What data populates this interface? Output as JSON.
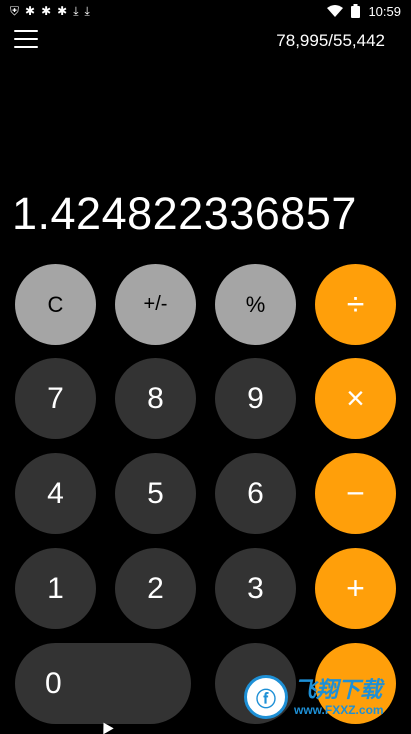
{
  "status_bar": {
    "left_icons": [
      "shield-icon",
      "bug-icon",
      "bug-icon",
      "bug-icon",
      "download-icon",
      "download-icon"
    ],
    "time": "10:59"
  },
  "header": {
    "expression": "78,995/55,442"
  },
  "display": {
    "value": "1.424822336857"
  },
  "keys": {
    "clear": "C",
    "plus_minus": "+/-",
    "percent": "%",
    "divide": "÷",
    "seven": "7",
    "eight": "8",
    "nine": "9",
    "multiply": "×",
    "four": "4",
    "five": "5",
    "six": "6",
    "minus": "−",
    "one": "1",
    "two": "2",
    "three": "3",
    "plus": "+",
    "zero": "0"
  },
  "watermark": {
    "name": "飞翔下载",
    "url": "www.FXXZ.com"
  },
  "colors": {
    "background": "#000000",
    "function_key": "#a5a5a5",
    "number_key": "#333333",
    "operator_key": "#ff9f0a"
  }
}
